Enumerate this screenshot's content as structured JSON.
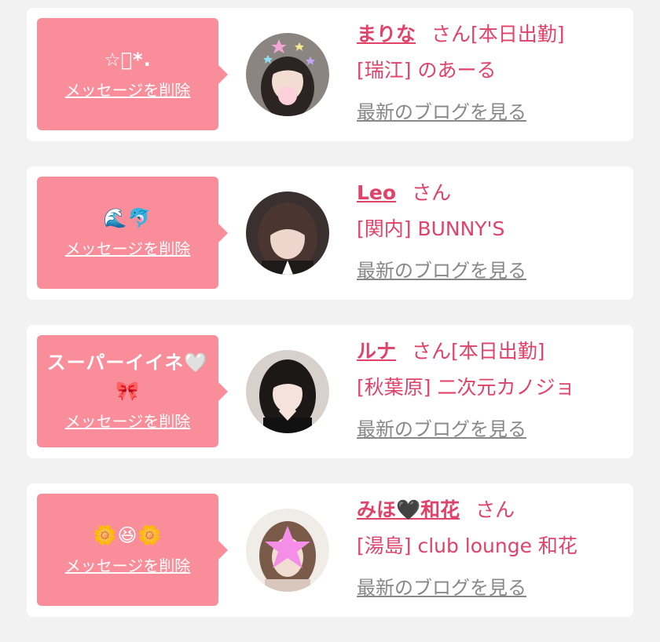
{
  "cards": [
    {
      "message": "☆ﾟ*.",
      "delete_label": "メッセージを削除",
      "name": "まりな",
      "suffix": "さん[本日出勤]",
      "area_shop": "[瑞江] のあーる",
      "blog_label": "最新のブログを見る",
      "avatar": "photo-avatar-girl-dark-hair-stars"
    },
    {
      "message": "🌊🐬",
      "delete_label": "メッセージを削除",
      "name": "Leo",
      "suffix": "さん",
      "area_shop": "[関内] BUNNY'S",
      "blog_label": "最新のブログを見る",
      "avatar": "photo-avatar-girl-dark-room"
    },
    {
      "message": "スーパーイイネ🤍",
      "message2": "🎀",
      "delete_label": "メッセージを削除",
      "name": "ルナ",
      "suffix": "さん[本日出勤]",
      "area_shop": "[秋葉原] 二次元カノジョ",
      "blog_label": "最新のブログを見る",
      "avatar": "photo-avatar-girl-heart-hands"
    },
    {
      "message": "🌼😆🌼",
      "delete_label": "メッセージを削除",
      "name": "みほ🖤和花",
      "suffix": "さん",
      "area_shop": "[湯島] club lounge 和花",
      "blog_label": "最新のブログを見る",
      "avatar": "photo-avatar-girl-pink-star-cover"
    }
  ],
  "colors": {
    "bubble": "#f98d9a",
    "name": "#e0426a",
    "link_gray": "#888888",
    "page_bg": "#f2f2f2"
  }
}
